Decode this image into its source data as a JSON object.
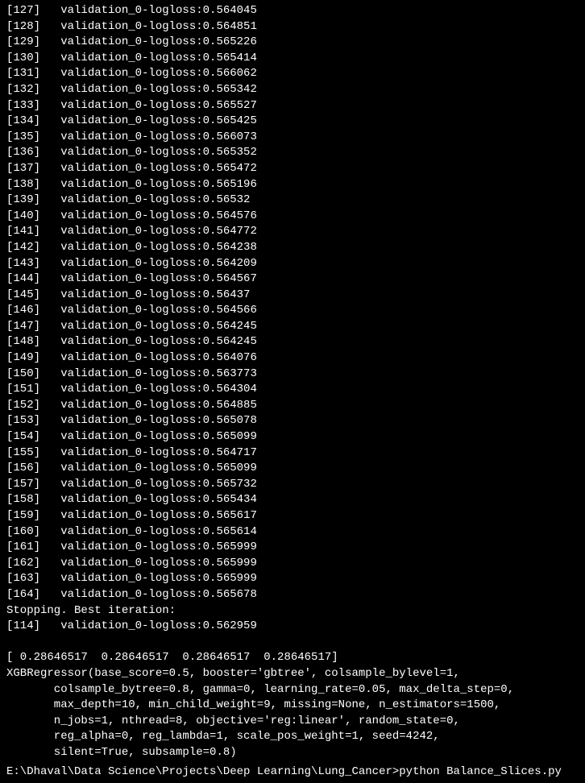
{
  "iterations": [
    {
      "idx": 127,
      "metric": "validation_0-logloss",
      "val": "0.564045"
    },
    {
      "idx": 128,
      "metric": "validation_0-logloss",
      "val": "0.564851"
    },
    {
      "idx": 129,
      "metric": "validation_0-logloss",
      "val": "0.565226"
    },
    {
      "idx": 130,
      "metric": "validation_0-logloss",
      "val": "0.565414"
    },
    {
      "idx": 131,
      "metric": "validation_0-logloss",
      "val": "0.566062"
    },
    {
      "idx": 132,
      "metric": "validation_0-logloss",
      "val": "0.565342"
    },
    {
      "idx": 133,
      "metric": "validation_0-logloss",
      "val": "0.565527"
    },
    {
      "idx": 134,
      "metric": "validation_0-logloss",
      "val": "0.565425"
    },
    {
      "idx": 135,
      "metric": "validation_0-logloss",
      "val": "0.566073"
    },
    {
      "idx": 136,
      "metric": "validation_0-logloss",
      "val": "0.565352"
    },
    {
      "idx": 137,
      "metric": "validation_0-logloss",
      "val": "0.565472"
    },
    {
      "idx": 138,
      "metric": "validation_0-logloss",
      "val": "0.565196"
    },
    {
      "idx": 139,
      "metric": "validation_0-logloss",
      "val": "0.56532"
    },
    {
      "idx": 140,
      "metric": "validation_0-logloss",
      "val": "0.564576"
    },
    {
      "idx": 141,
      "metric": "validation_0-logloss",
      "val": "0.564772"
    },
    {
      "idx": 142,
      "metric": "validation_0-logloss",
      "val": "0.564238"
    },
    {
      "idx": 143,
      "metric": "validation_0-logloss",
      "val": "0.564209"
    },
    {
      "idx": 144,
      "metric": "validation_0-logloss",
      "val": "0.564567"
    },
    {
      "idx": 145,
      "metric": "validation_0-logloss",
      "val": "0.56437"
    },
    {
      "idx": 146,
      "metric": "validation_0-logloss",
      "val": "0.564566"
    },
    {
      "idx": 147,
      "metric": "validation_0-logloss",
      "val": "0.564245"
    },
    {
      "idx": 148,
      "metric": "validation_0-logloss",
      "val": "0.564245"
    },
    {
      "idx": 149,
      "metric": "validation_0-logloss",
      "val": "0.564076"
    },
    {
      "idx": 150,
      "metric": "validation_0-logloss",
      "val": "0.563773"
    },
    {
      "idx": 151,
      "metric": "validation_0-logloss",
      "val": "0.564304"
    },
    {
      "idx": 152,
      "metric": "validation_0-logloss",
      "val": "0.564885"
    },
    {
      "idx": 153,
      "metric": "validation_0-logloss",
      "val": "0.565078"
    },
    {
      "idx": 154,
      "metric": "validation_0-logloss",
      "val": "0.565099"
    },
    {
      "idx": 155,
      "metric": "validation_0-logloss",
      "val": "0.564717"
    },
    {
      "idx": 156,
      "metric": "validation_0-logloss",
      "val": "0.565099"
    },
    {
      "idx": 157,
      "metric": "validation_0-logloss",
      "val": "0.565732"
    },
    {
      "idx": 158,
      "metric": "validation_0-logloss",
      "val": "0.565434"
    },
    {
      "idx": 159,
      "metric": "validation_0-logloss",
      "val": "0.565617"
    },
    {
      "idx": 160,
      "metric": "validation_0-logloss",
      "val": "0.565614"
    },
    {
      "idx": 161,
      "metric": "validation_0-logloss",
      "val": "0.565999"
    },
    {
      "idx": 162,
      "metric": "validation_0-logloss",
      "val": "0.565999"
    },
    {
      "idx": 163,
      "metric": "validation_0-logloss",
      "val": "0.565999"
    },
    {
      "idx": 164,
      "metric": "validation_0-logloss",
      "val": "0.565678"
    }
  ],
  "stopping_line": "Stopping. Best iteration:",
  "best_iter": {
    "idx": 114,
    "metric": "validation_0-logloss",
    "val": "0.562959"
  },
  "array_line": "[ 0.28646517  0.28646517  0.28646517  0.28646517]",
  "regressor": {
    "l1": "XGBRegressor(base_score=0.5, booster='gbtree', colsample_bylevel=1,",
    "l2": "       colsample_bytree=0.8, gamma=0, learning_rate=0.05, max_delta_step=0,",
    "l3": "       max_depth=10, min_child_weight=9, missing=None, n_estimators=1500,",
    "l4": "       n_jobs=1, nthread=8, objective='reg:linear', random_state=0,",
    "l5": "       reg_alpha=0, reg_lambda=1, scale_pos_weight=1, seed=4242,",
    "l6": "       silent=True, subsample=0.8)"
  },
  "prompt": {
    "path": "E:\\Dhaval\\Data Science\\Projects\\Deep Learning\\Lung_Cancer>",
    "command": "python Balance_Slices.py"
  }
}
